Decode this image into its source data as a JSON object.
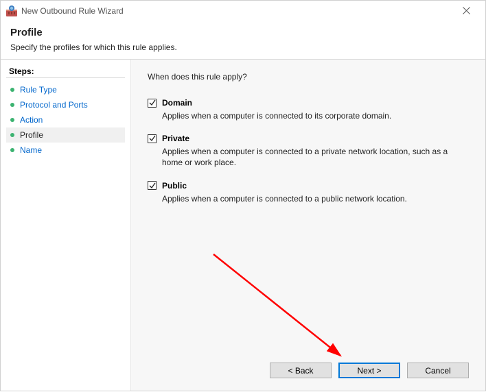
{
  "window": {
    "title": "New Outbound Rule Wizard"
  },
  "header": {
    "title": "Profile",
    "subtitle": "Specify the profiles for which this rule applies."
  },
  "sidebar": {
    "title": "Steps:",
    "items": [
      {
        "label": "Rule Type",
        "current": false
      },
      {
        "label": "Protocol and Ports",
        "current": false
      },
      {
        "label": "Action",
        "current": false
      },
      {
        "label": "Profile",
        "current": true
      },
      {
        "label": "Name",
        "current": false
      }
    ]
  },
  "main": {
    "question": "When does this rule apply?",
    "options": [
      {
        "label": "Domain",
        "checked": true,
        "description": "Applies when a computer is connected to its corporate domain."
      },
      {
        "label": "Private",
        "checked": true,
        "description": "Applies when a computer is connected to a private network location, such as a home or work place."
      },
      {
        "label": "Public",
        "checked": true,
        "description": "Applies when a computer is connected to a public network location."
      }
    ]
  },
  "footer": {
    "back": "< Back",
    "next": "Next >",
    "cancel": "Cancel"
  }
}
